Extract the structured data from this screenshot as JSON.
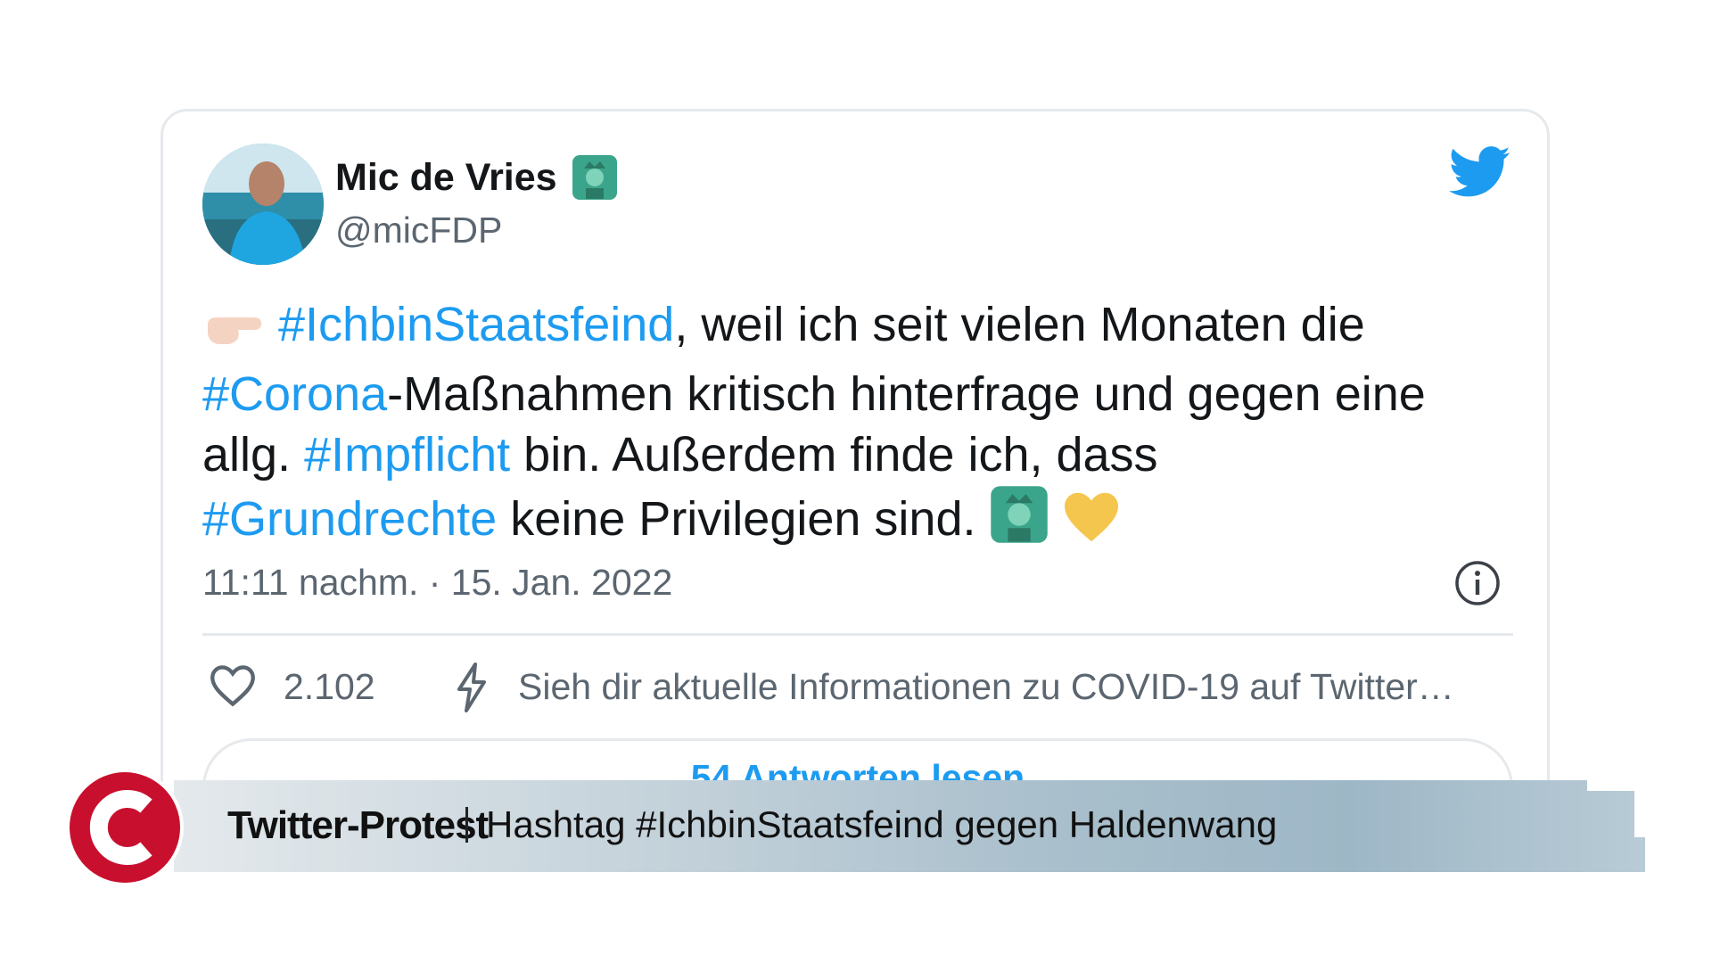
{
  "tweet": {
    "author": {
      "display_name": "Mic de Vries",
      "handle": "@micFDP",
      "avatar_icon": "person-photo-avatar",
      "name_emoji_icon": "statue-of-liberty-icon"
    },
    "brand_icon": "twitter-bird-icon",
    "body_lines": [
      {
        "emoji_lead": "backhand-index-pointing-left-icon",
        "hashtag": "#IchbinStaatsfeind",
        "text": ", weil ich seit vielen Monaten die"
      },
      {
        "hashtag": "#Corona",
        "text": "-Maßnahmen kritisch hinterfrage und gegen eine"
      },
      {
        "prefix": "allg. ",
        "hashtag": "#Impflicht",
        "text": " bin. Außerdem finde ich, dass"
      },
      {
        "hashtag": "#Grundrechte",
        "text": " keine Privilegien sind. ",
        "emoji_trail": [
          "statue-of-liberty-icon",
          "yellow-heart-icon"
        ]
      }
    ],
    "timestamp": "11:11 nachm. · 15. Jan. 2022",
    "info_icon": "info-icon",
    "likes": "2.102",
    "covid_info_text": "Sieh dir aktuelle Informationen zu COVID-19 auf Twitter…",
    "replies_label": "54 Antworten lesen"
  },
  "lower_third": {
    "title": "Twitter-Protest",
    "text": "Hashtag #IchbinStaatsfeind gegen Haldenwang",
    "logo_icon": "channel-c-logo"
  },
  "colors": {
    "hashtag": "#1d9bf0",
    "text_primary": "#14171a",
    "text_secondary": "#5b6670",
    "logo_red": "#c8102e",
    "twitter_blue": "#1d9bf0"
  }
}
